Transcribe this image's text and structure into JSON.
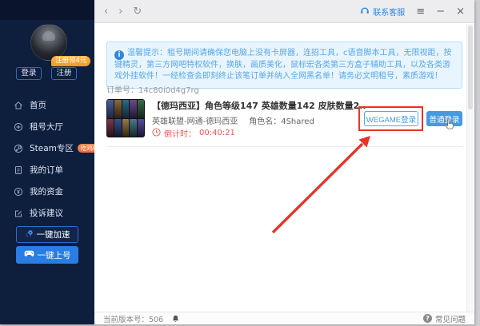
{
  "titlebar": {
    "contact_support": "联系客服"
  },
  "sidebar": {
    "login_label": "登录",
    "register_label": "注册",
    "register_badge": "注册领4元",
    "menu": [
      {
        "label": "首页",
        "icon": "home-icon"
      },
      {
        "label": "租号大厅",
        "icon": "hall-icon"
      },
      {
        "label": "Steam专区",
        "icon": "steam-icon",
        "badge": "吃鸡0元"
      },
      {
        "label": "我的订单",
        "icon": "orders-icon"
      },
      {
        "label": "我的资金",
        "icon": "funds-icon"
      },
      {
        "label": "投诉建议",
        "icon": "feedback-icon"
      }
    ],
    "accelerate_button": "一键加速",
    "onekey_button": "一键上号"
  },
  "main": {
    "notice": "温馨提示：租号期间请确保您电脑上没有卡屏器，连招工具，c语音脚本工具，无限视距，按键精灵，第三方网吧特权软件，换肤，画质美化，鼠标宏各类第三方盒子辅助工具，以及各类游戏外挂软件！一经检查会即刻终止该笔订单并纳入全网黑名单！请务必文明租号，素质游戏！",
    "order_no_label": "订单号：",
    "order_no": "14c80i0d4g7rg",
    "order": {
      "title": "【德玛西亚】角色等级147 英雄数量142 皮肤数量2..",
      "game_info": "英雄联盟-网通-德玛西亚",
      "role_label": "角色名：",
      "role_name": "4Shared",
      "countdown_label": "倒计时：",
      "countdown_value": "00:40:21",
      "wegame_button": "WEGAME登录",
      "normal_button": "普通登录"
    }
  },
  "statusbar": {
    "version_label": "当前版本号：",
    "version": "506",
    "faq_label": "常见问题"
  },
  "colors": {
    "accent": "#2e86e0",
    "accent_light": "#459ae2",
    "sidebar_bg": "#0e1f3d",
    "primary_button": "#2a7de2",
    "badge_orange": "#f59a23",
    "steam_badge": "#f96a3d",
    "notice_bg": "#e9f5fe",
    "notice_text": "#58a6e8",
    "countdown_red": "#f25555",
    "annotation_red": "#e5352b"
  }
}
